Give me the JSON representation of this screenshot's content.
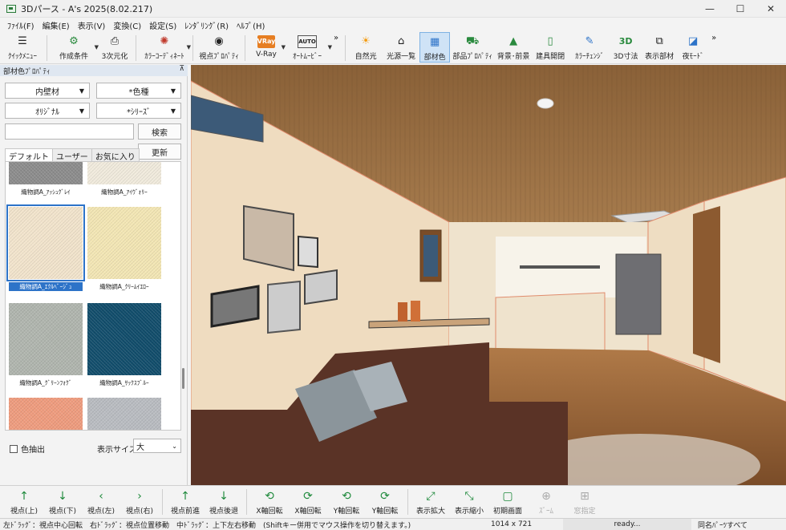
{
  "window": {
    "title": "3Dパース - A's 2025(8.02.217)",
    "minimize": "—",
    "maximize": "☐",
    "close": "✕"
  },
  "menu": [
    "ﾌｧｲﾙ(F)",
    "編集(E)",
    "表示(V)",
    "変換(C)",
    "設定(S)",
    "ﾚﾝﾀﾞﾘﾝｸﾞ(R)",
    "ﾍﾙﾌﾟ(H)"
  ],
  "toolbar": {
    "quick_menu": "ｸｲｯｸﾒﾆｭｰ",
    "create_condition": "作成条件",
    "to_3d": "3次元化",
    "color_coordinate": "ｶﾗｰｺｰﾃﾞｨﾈｰﾄ",
    "viewpoint_property": "視点ﾌﾟﾛﾊﾟﾃｨ",
    "vray": "V-Ray",
    "auto_movie": "ｵｰﾄﾑｰﾋﾞｰ",
    "chevron": "»",
    "natural_light": "自然光",
    "light_list": "光源一覧",
    "material_color": "部材色",
    "part_property": "部品ﾌﾟﾛﾊﾟﾃｨ",
    "background": "背景･前景",
    "fixture_open": "建具開閉",
    "color_change": "ｶﾗｰﾁｪﾝｼﾞ",
    "dim_3d": "3D寸法",
    "display_parts": "表示部材",
    "night_mode": "夜ﾓｰﾄﾞ",
    "chevron2": "»",
    "vray_icon": "VRay",
    "dim_icon": "3D",
    "auto_icon": "AUTO"
  },
  "panel": {
    "title": "部材色ﾌﾟﾛﾊﾟﾃｨ",
    "pin": "⊼",
    "dropdown1": "内壁材",
    "dropdown2": "*色種",
    "dropdown3": "ｵﾘｼﾞﾅﾙ",
    "dropdown4": "*ｼﾘｰｽﾞ",
    "search_button": "検索",
    "update_button": "更新",
    "tabs": [
      "デフォルト",
      "ユーザー",
      "お気に入り"
    ],
    "swatches": [
      {
        "name": "織物調A_ｱｯｼｭｸﾞﾚｲ",
        "color": "#8c8c8c"
      },
      {
        "name": "織物調A_ｱｲｳﾞｫﾘｰ",
        "color": "#f1ebdd"
      },
      {
        "name": "織物調A_ｴｸﾙﾍﾞｰｼﾞｭ",
        "color": "#f2e4cc"
      },
      {
        "name": "織物調A_ｸﾘｰﾑｲｴﾛｰ",
        "color": "#f3e6b4"
      },
      {
        "name": "織物調A_ｸﾞﾘｰﾝﾌｫｸﾞ",
        "color": "#b0b5ae"
      },
      {
        "name": "織物調A_ｻｯｸｽﾌﾞﾙｰ",
        "color": "#114d6b"
      },
      {
        "name": "",
        "color": "#ef9c7e"
      },
      {
        "name": "",
        "color": "#b9bcc1"
      }
    ],
    "color_extract": "色抽出",
    "display_size_label": "表示サイズ",
    "display_size_value": "大"
  },
  "bottombar": {
    "buttons": [
      {
        "icon": "↑",
        "label": "視点(上)"
      },
      {
        "icon": "↓",
        "label": "視点(下)"
      },
      {
        "icon": "‹",
        "label": "視点(左)"
      },
      {
        "icon": "›",
        "label": "視点(右)"
      },
      {
        "icon": "↑",
        "label": "視点前進"
      },
      {
        "icon": "↓",
        "label": "視点後退"
      },
      {
        "icon": "⟲",
        "label": "X軸回転"
      },
      {
        "icon": "⟳",
        "label": "X軸回転"
      },
      {
        "icon": "⟲",
        "label": "Y軸回転"
      },
      {
        "icon": "⟳",
        "label": "Y軸回転"
      },
      {
        "icon": "⤢",
        "label": "表示拡大"
      },
      {
        "icon": "⤡",
        "label": "表示縮小"
      },
      {
        "icon": "▢",
        "label": "初期画面"
      },
      {
        "icon": "⊕",
        "label": "ｽﾞｰﾑ"
      },
      {
        "icon": "⊞",
        "label": "窓指定"
      }
    ]
  },
  "status": {
    "hint": "左ﾄﾞﾗｯｸﾞ：視点中心回転　右ﾄﾞﾗｯｸﾞ：視点位置移動　中ﾄﾞﾗｯｸﾞ：上下左右移動　(Shiftキー併用でマウス操作を切り替えます。)",
    "size": "1014 x 721",
    "ready": "ready...",
    "mode": "同名ﾊﾟｰﾂすべて"
  }
}
